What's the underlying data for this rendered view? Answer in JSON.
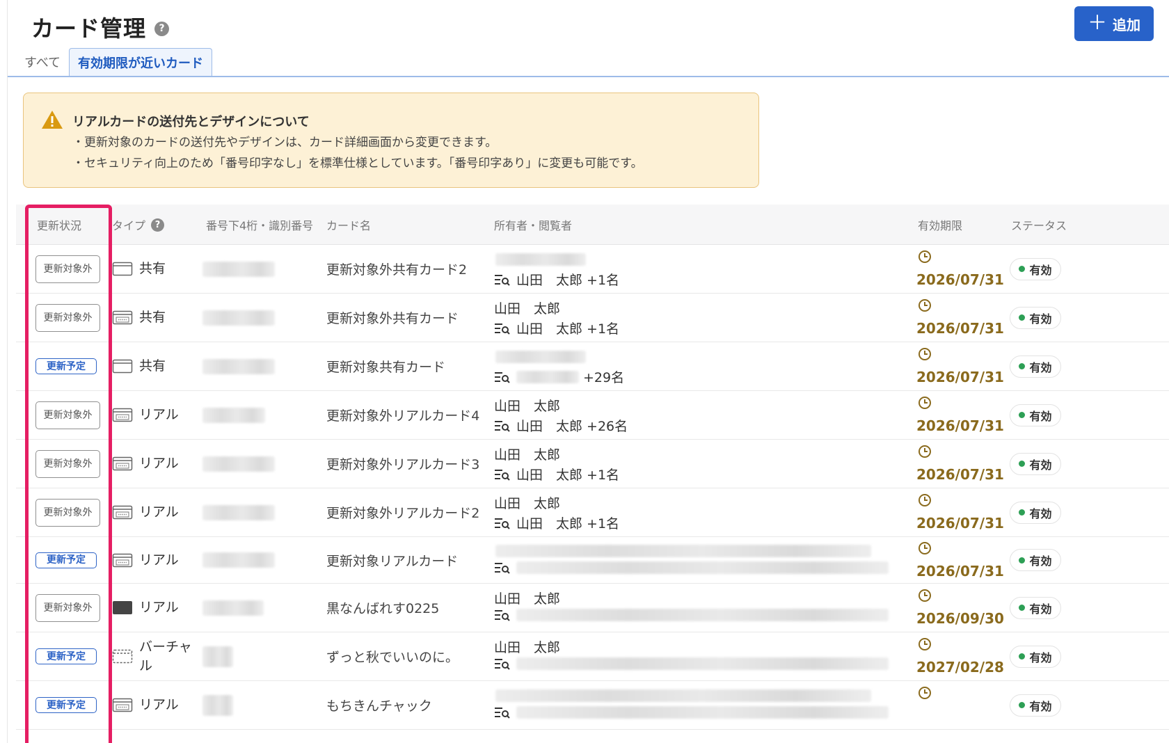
{
  "header": {
    "title": "カード管理",
    "help": "?",
    "add_label": "追加",
    "add_icon": "＋"
  },
  "tabs": [
    {
      "label": "すべて",
      "active": false
    },
    {
      "label": "有効期限が近いカード",
      "active": true
    }
  ],
  "notice": {
    "title": "リアルカードの送付先とデザインについて",
    "lines": [
      "・更新対象のカードの送付先やデザインは、カード詳細画面から変更できます。",
      "・セキュリティ向上のため「番号印字なし」を標準仕様としています。「番号印字あり」に変更も可能です。"
    ]
  },
  "columns": {
    "renewal": "更新状況",
    "type": "タイプ",
    "type_help": "?",
    "number": "番号下4桁・識別番号",
    "name": "カード名",
    "owner": "所有者・閲覧者",
    "expiry": "有効期限",
    "status": "ステータス"
  },
  "rows": [
    {
      "renewal": "更新対象外",
      "renewal_kind": "out",
      "type": "共有",
      "type_icon": "shared-card-icon",
      "name": "更新対象外共有カード2",
      "owner": "",
      "viewers": "山田　太郎 +1名",
      "expiry": "2026/07/31",
      "status": "有効"
    },
    {
      "renewal": "更新対象外",
      "renewal_kind": "out",
      "type": "共有",
      "type_icon": "numbered-card-icon",
      "name": "更新対象外共有カード",
      "owner": "山田　太郎",
      "viewers": "山田　太郎 +1名",
      "expiry": "2026/07/31",
      "status": "有効"
    },
    {
      "renewal": "更新予定",
      "renewal_kind": "plan",
      "type": "共有",
      "type_icon": "shared-card-icon",
      "name": "更新対象共有カード",
      "owner": "",
      "viewers": "+29名",
      "expiry": "2026/07/31",
      "status": "有効"
    },
    {
      "renewal": "更新対象外",
      "renewal_kind": "out",
      "type": "リアル",
      "type_icon": "numbered-card-icon",
      "name": "更新対象外リアルカード4",
      "owner": "山田　太郎",
      "viewers": "山田　太郎 +26名",
      "expiry": "2026/07/31",
      "status": "有効"
    },
    {
      "renewal": "更新対象外",
      "renewal_kind": "out",
      "type": "リアル",
      "type_icon": "numbered-card-icon",
      "name": "更新対象外リアルカード3",
      "owner": "山田　太郎",
      "viewers": "山田　太郎 +1名",
      "expiry": "2026/07/31",
      "status": "有効"
    },
    {
      "renewal": "更新対象外",
      "renewal_kind": "out",
      "type": "リアル",
      "type_icon": "numbered-card-icon",
      "name": "更新対象外リアルカード2",
      "owner": "山田　太郎",
      "viewers": "山田　太郎 +1名",
      "expiry": "2026/07/31",
      "status": "有効"
    },
    {
      "renewal": "更新予定",
      "renewal_kind": "plan",
      "type": "リアル",
      "type_icon": "numbered-card-icon",
      "name": "更新対象リアルカード",
      "owner": "",
      "viewers": "",
      "expiry": "2026/07/31",
      "status": "有効"
    },
    {
      "renewal": "更新対象外",
      "renewal_kind": "out",
      "type": "リアル",
      "type_icon": "black-card-icon",
      "name": "黒なんばれす0225",
      "owner": "山田　太郎",
      "viewers": "",
      "expiry": "2026/09/30",
      "status": "有効"
    },
    {
      "renewal": "更新予定",
      "renewal_kind": "plan",
      "type": "バーチャル",
      "type_icon": "virtual-card-icon",
      "name": "ずっと秋でいいのに。",
      "owner": "山田　太郎",
      "viewers": "",
      "expiry": "2027/02/28",
      "status": "有効"
    },
    {
      "renewal": "更新予定",
      "renewal_kind": "plan",
      "type": "リアル",
      "type_icon": "numbered-card-icon",
      "name": "もちきんチャック",
      "owner": "",
      "viewers": "",
      "expiry": "",
      "status": "有効"
    }
  ],
  "colors": {
    "accent": "#2862c9",
    "expiry": "#8a6a1d",
    "status_dot": "#2d9f55",
    "highlight": "#e51e63",
    "notice_bg": "#fdf1d6"
  }
}
